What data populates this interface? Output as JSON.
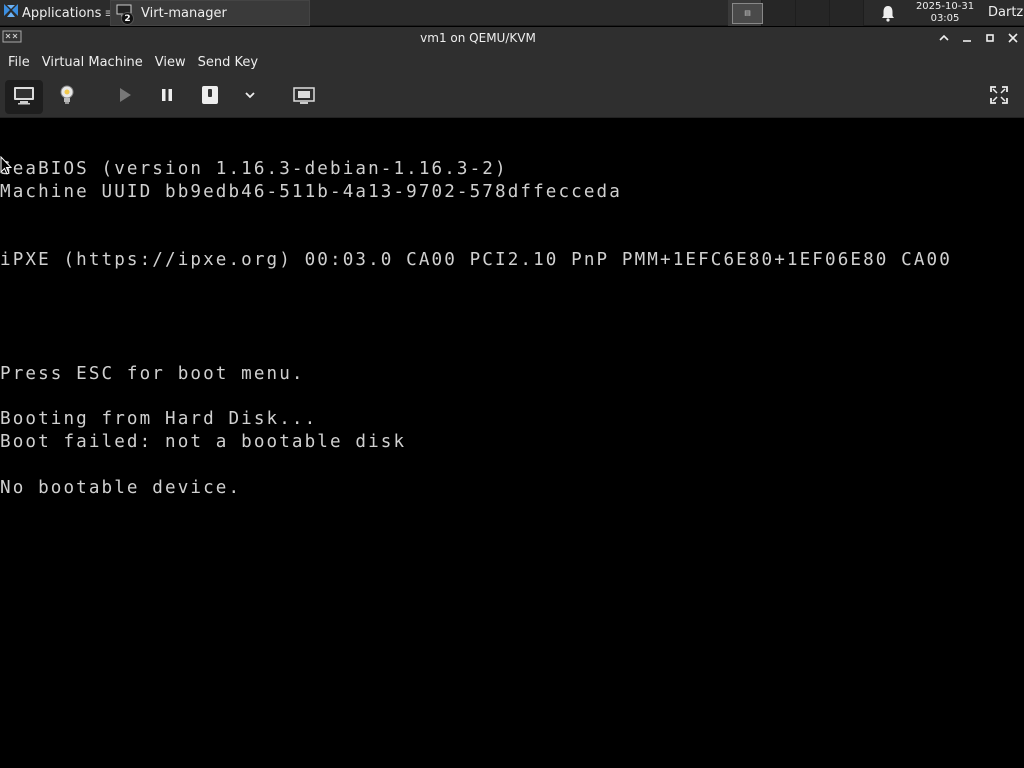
{
  "panel": {
    "applications_label": "Applications",
    "task_label": "Virt-manager",
    "task_badge": "2",
    "clock_date": "2025-10-31",
    "clock_time": "03:05",
    "user": "Dartz"
  },
  "window": {
    "title": "vm1 on QEMU/KVM"
  },
  "menubar": {
    "items": [
      "File",
      "Virtual Machine",
      "View",
      "Send Key"
    ]
  },
  "toolbar": {
    "icons": [
      "monitor-icon",
      "lightbulb-icon",
      "play-icon",
      "pause-icon",
      "power-icon",
      "chevron-down-icon",
      "screenshot-icon",
      "fullscreen-icon"
    ]
  },
  "console": {
    "lines": [
      "SeaBIOS (version 1.16.3-debian-1.16.3-2)",
      "Machine UUID bb9edb46-511b-4a13-9702-578dffecceda",
      "iPXE (https://ipxe.org) 00:03.0 CA00 PCI2.10 PnP PMM+1EFC6E80+1EF06E80 CA00",
      "Press ESC for boot menu.",
      "Booting from Hard Disk...",
      "Boot failed: not a bootable disk",
      "No bootable device."
    ]
  },
  "colors": {
    "panel_bg": "#2b2b2b",
    "window_bg": "#2f2f2f",
    "console_bg": "#000000",
    "console_fg": "#d0d0d0"
  }
}
